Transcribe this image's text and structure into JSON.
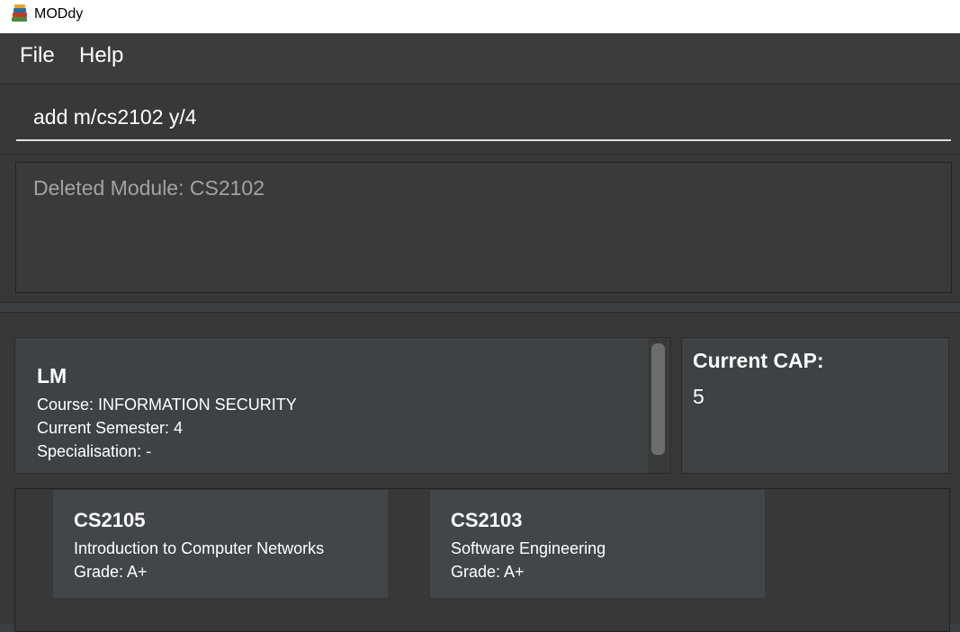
{
  "window": {
    "title": "MODdy",
    "icon": "books-icon"
  },
  "menu": {
    "items": [
      "File",
      "Help"
    ]
  },
  "command": {
    "value": "add m/cs2102 y/4"
  },
  "result": {
    "text": "Deleted Module: CS2102"
  },
  "profile": {
    "name": "LM",
    "course": "Course: INFORMATION SECURITY",
    "semester": "Current Semester: 4",
    "specialisation": "Specialisation: -"
  },
  "cap": {
    "label": "Current CAP:",
    "value": "5"
  },
  "modules": [
    {
      "code": "CS2105",
      "title": "Introduction to Computer Networks",
      "grade": "Grade: A+"
    },
    {
      "code": "CS2103",
      "title": "Software Engineering",
      "grade": "Grade: A+"
    }
  ],
  "colors": {
    "background": "#3c3f41",
    "card": "#434649",
    "result_text": "#a3a3a3"
  }
}
